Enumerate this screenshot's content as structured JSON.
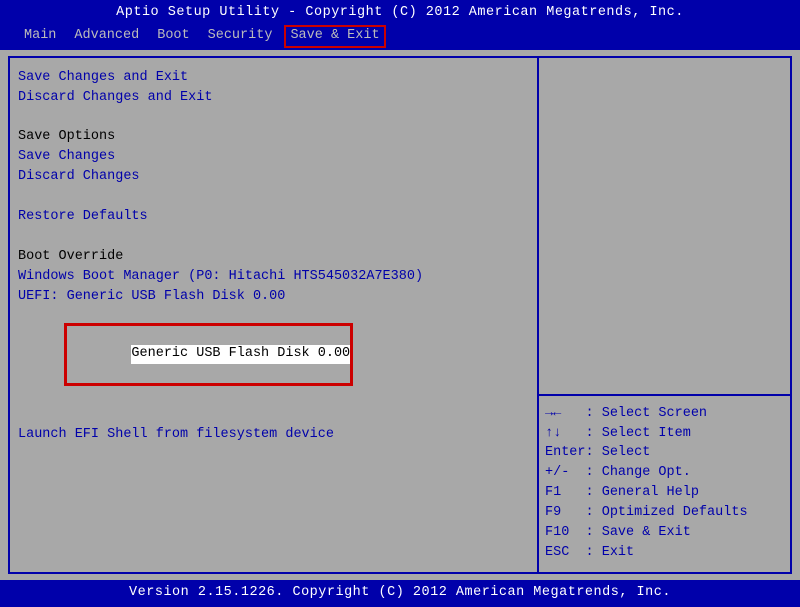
{
  "title": "Aptio Setup Utility - Copyright (C) 2012 American Megatrends, Inc.",
  "menu": {
    "items": [
      "Main",
      "Advanced",
      "Boot",
      "Security",
      "Save & Exit"
    ],
    "active_index": 4
  },
  "left": {
    "save_exit": "Save Changes and Exit",
    "discard_exit": "Discard Changes and Exit",
    "save_opts_header": "Save Options",
    "save_changes": "Save Changes",
    "discard_changes": "Discard Changes",
    "restore_defaults": "Restore Defaults",
    "boot_override_header": "Boot Override",
    "wbm": "Windows Boot Manager (P0: Hitachi HTS545032A7E380)",
    "uefi_usb": "UEFI: Generic USB Flash Disk 0.00",
    "generic_usb": "Generic USB Flash Disk 0.00",
    "launch_efi": "Launch EFI Shell from filesystem device"
  },
  "help": [
    {
      "key": "→←",
      "sep": "   : ",
      "label": "Select Screen"
    },
    {
      "key": "↑↓",
      "sep": "   : ",
      "label": "Select Item"
    },
    {
      "key": "Enter",
      "sep": ": ",
      "label": "Select"
    },
    {
      "key": "+/-",
      "sep": "  : ",
      "label": "Change Opt."
    },
    {
      "key": "F1",
      "sep": "   : ",
      "label": "General Help"
    },
    {
      "key": "F9",
      "sep": "   : ",
      "label": "Optimized Defaults"
    },
    {
      "key": "F10",
      "sep": "  : ",
      "label": "Save & Exit"
    },
    {
      "key": "ESC",
      "sep": "  : ",
      "label": "Exit"
    }
  ],
  "footer": "Version 2.15.1226. Copyright (C) 2012 American Megatrends, Inc."
}
